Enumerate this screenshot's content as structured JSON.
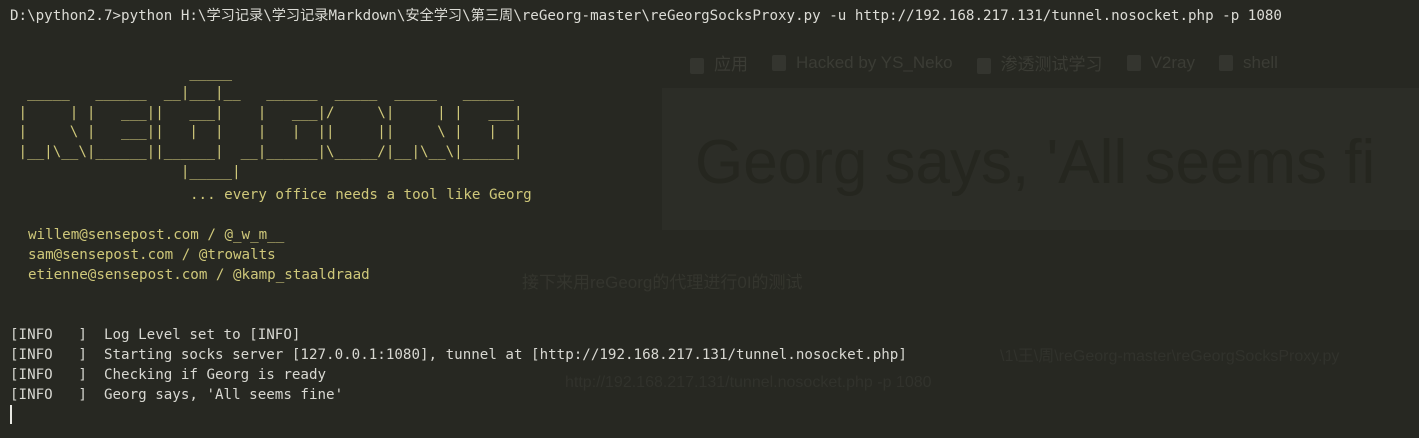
{
  "terminal": {
    "command": "D:\\python2.7>python H:\\学习记录\\学习记录Markdown\\安全学习\\第三周\\reGeorg-master\\reGeorgSocksProxy.py -u http://192.168.217.131/tunnel.nosocket.php -p 1080",
    "banner_art": "                     _____\n  _____   ______  __|___|__   ______  _____  _____   ______\n |     | |   ___||   ___|    |   ___|/     \\|     | |   ___|\n |     \\ |   ___||   |  |    |   |  ||     ||     \\ |   |  |\n |__|\\__\\|______||______|  __|______|\\_____/|__|\\__\\|______|\n                    |_____|",
    "tagline": "... every office needs a tool like Georg",
    "credits": [
      "willem@sensepost.com / @_w_m__",
      "sam@sensepost.com / @trowalts",
      "etienne@sensepost.com / @kamp_staaldraad"
    ],
    "log_lines": [
      "[INFO   ]  Log Level set to [INFO]",
      "[INFO   ]  Starting socks server [127.0.0.1:1080], tunnel at [http://192.168.217.131/tunnel.nosocket.php]",
      "[INFO   ]  Checking if Georg is ready",
      "[INFO   ]  Georg says, 'All seems fine'"
    ]
  },
  "background_ghost": {
    "bookmarks": [
      "应用",
      "Hacked by YS_Neko",
      "渗透测试学习",
      "V2ray",
      "shell"
    ],
    "headline": "Georg says, 'All seems fi",
    "subtitle": "接下来用reGeorg的代理进行0I的测试",
    "path_fragment": "\\1\\王\\周\\reGeorg-master\\reGeorgSocksProxy.py",
    "url_fragment": "http://192.168.217.131/tunnel.nosocket.php -p 1080"
  },
  "colors": {
    "background": "#272822",
    "text": "#d8d8d2",
    "banner": "#cfc87a"
  }
}
